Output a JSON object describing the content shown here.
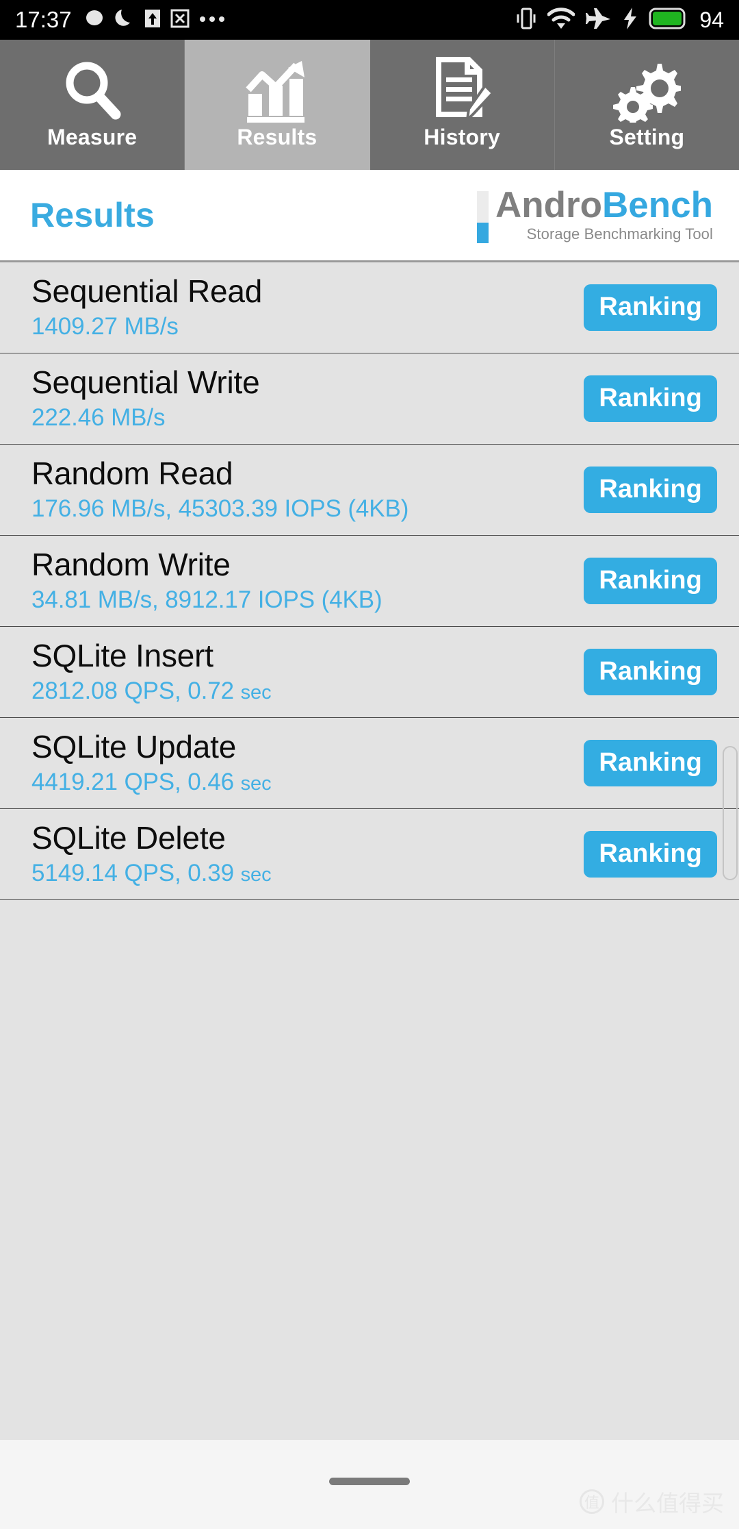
{
  "status_bar": {
    "time": "17:37",
    "left_icons": [
      "message-bubble-icon",
      "do-not-disturb-moon-icon",
      "upload-arrow-icon",
      "screenshot-icon",
      "more-dots-icon"
    ],
    "right_icons": [
      "vibrate-icon",
      "wifi-icon",
      "airplane-mode-icon",
      "charging-bolt-icon",
      "battery-icon"
    ],
    "battery_level": "94"
  },
  "tabs": [
    {
      "label": "Measure",
      "icon": "magnifier-icon",
      "active": false
    },
    {
      "label": "Results",
      "icon": "bar-chart-arrow-icon",
      "active": true
    },
    {
      "label": "History",
      "icon": "document-pencil-icon",
      "active": false
    },
    {
      "label": "Setting",
      "icon": "gears-icon",
      "active": false
    }
  ],
  "header": {
    "title": "Results",
    "brand_first": "Andro",
    "brand_second": "Bench",
    "brand_tagline": "Storage Benchmarking Tool"
  },
  "results": [
    {
      "name": "Sequential Read",
      "value": "1409.27 MB/s",
      "button": "Ranking"
    },
    {
      "name": "Sequential Write",
      "value": "222.46 MB/s",
      "button": "Ranking"
    },
    {
      "name": "Random Read",
      "value": "176.96 MB/s, 45303.39 IOPS (4KB)",
      "button": "Ranking"
    },
    {
      "name": "Random Write",
      "value": "34.81 MB/s, 8912.17 IOPS (4KB)",
      "button": "Ranking"
    },
    {
      "name": "SQLite Insert",
      "value": "2812.08 QPS, 0.72 ",
      "unit": "sec",
      "button": "Ranking"
    },
    {
      "name": "SQLite Update",
      "value": "4419.21 QPS, 0.46 ",
      "unit": "sec",
      "button": "Ranking"
    },
    {
      "name": "SQLite Delete",
      "value": "5149.14 QPS, 0.39 ",
      "unit": "sec",
      "button": "Ranking"
    }
  ],
  "watermark": {
    "logo_glyph": "值",
    "text": "什么值得买"
  },
  "colors": {
    "accent_blue": "#33ade2",
    "title_blue": "#3aabe0",
    "value_blue": "#44b0e4",
    "tab_inactive": "#6e6e6e",
    "tab_active": "#b4b4b4",
    "list_bg": "#e3e3e3",
    "battery_green": "#1fb520"
  }
}
